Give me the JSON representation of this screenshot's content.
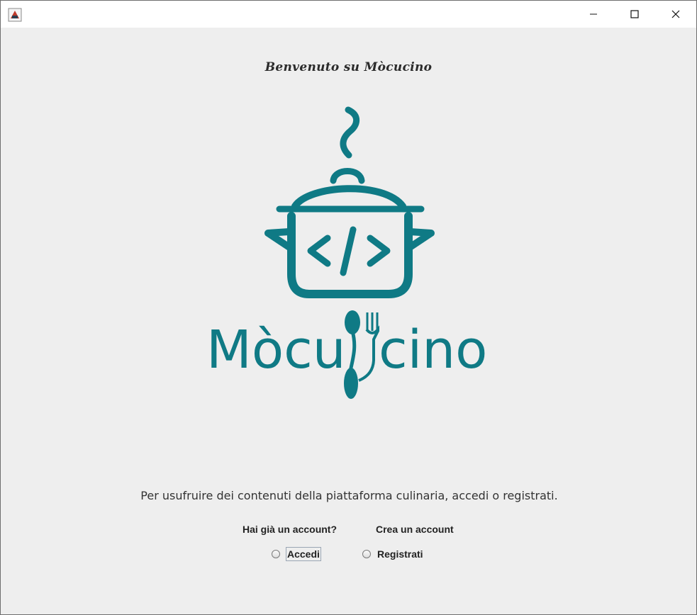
{
  "window": {
    "controls": {
      "minimize": "minimize-icon",
      "maximize": "maximize-icon",
      "close": "close-icon"
    }
  },
  "welcome": {
    "title": "Benvenuto su Mòcucino"
  },
  "logo": {
    "text_left": "Mòcu",
    "text_right": "cino",
    "icon": "pot-code-icon",
    "color": "#0f7a85"
  },
  "instruction": "Per usufruire dei contenuti della piattaforma culinaria, accedi o registrati.",
  "login": {
    "label": "Hai già un account?",
    "option": "Accedi",
    "selected": false
  },
  "register": {
    "label": "Crea un account",
    "option": "Registrati",
    "selected": false
  }
}
